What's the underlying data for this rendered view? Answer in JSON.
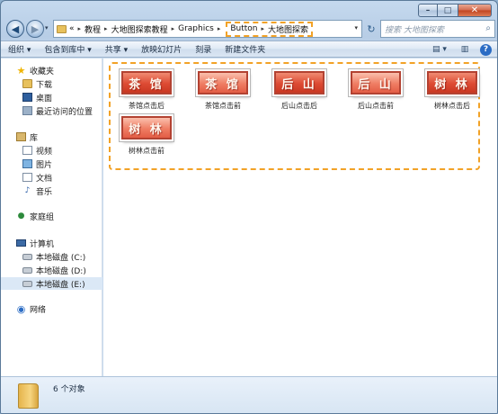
{
  "window": {
    "caption": {
      "min_glyph": "–",
      "max_glyph": "□",
      "close_glyph": "✕"
    }
  },
  "nav": {
    "back_glyph": "◀",
    "forward_glyph": "▶",
    "dropdown_glyph": "▾"
  },
  "address": {
    "overflow": "«",
    "crumbs": [
      "教程",
      "大地图探索教程",
      "Graphics"
    ],
    "highlight_crumbs": [
      "Button",
      "大地图探索"
    ],
    "separator": "▸",
    "dropdown_glyph": "▾"
  },
  "refresh_glyph": "↻",
  "search": {
    "placeholder": "搜索 大地图探索",
    "icon_glyph": "⌕"
  },
  "toolbar": {
    "organize": "组织 ▾",
    "include_library": "包含到库中 ▾",
    "share": "共享 ▾",
    "slideshow": "放映幻灯片",
    "burn": "刻录",
    "new_folder": "新建文件夹",
    "view_glyph": "▤ ▾",
    "pane_glyph": "▥",
    "help_glyph": "?"
  },
  "sidebar": {
    "favorites": {
      "label": "收藏夹",
      "items": [
        "下载",
        "桌面",
        "最近访问的位置"
      ]
    },
    "libraries": {
      "label": "库",
      "items": [
        "视频",
        "图片",
        "文档",
        "音乐"
      ]
    },
    "homegroup": "家庭组",
    "computer": {
      "label": "计算机",
      "items": [
        "本地磁盘 (C:)",
        "本地磁盘 (D:)",
        "本地磁盘 (E:)"
      ]
    },
    "network": "网络"
  },
  "files": [
    {
      "thumb": "茶 馆",
      "name": "茶馆点击后"
    },
    {
      "thumb": "茶 馆",
      "name": "茶馆点击前"
    },
    {
      "thumb": "后 山",
      "name": "后山点击后"
    },
    {
      "thumb": "后 山",
      "name": "后山点击前"
    },
    {
      "thumb": "树 林",
      "name": "树林点击后"
    },
    {
      "thumb": "树 林",
      "name": "树林点击前"
    }
  ],
  "details": {
    "count": "6 个对象"
  },
  "colors": {
    "highlight_dash": "#f2a227",
    "thumb_red": "#e8604a",
    "selection": "#dbe8f6"
  }
}
